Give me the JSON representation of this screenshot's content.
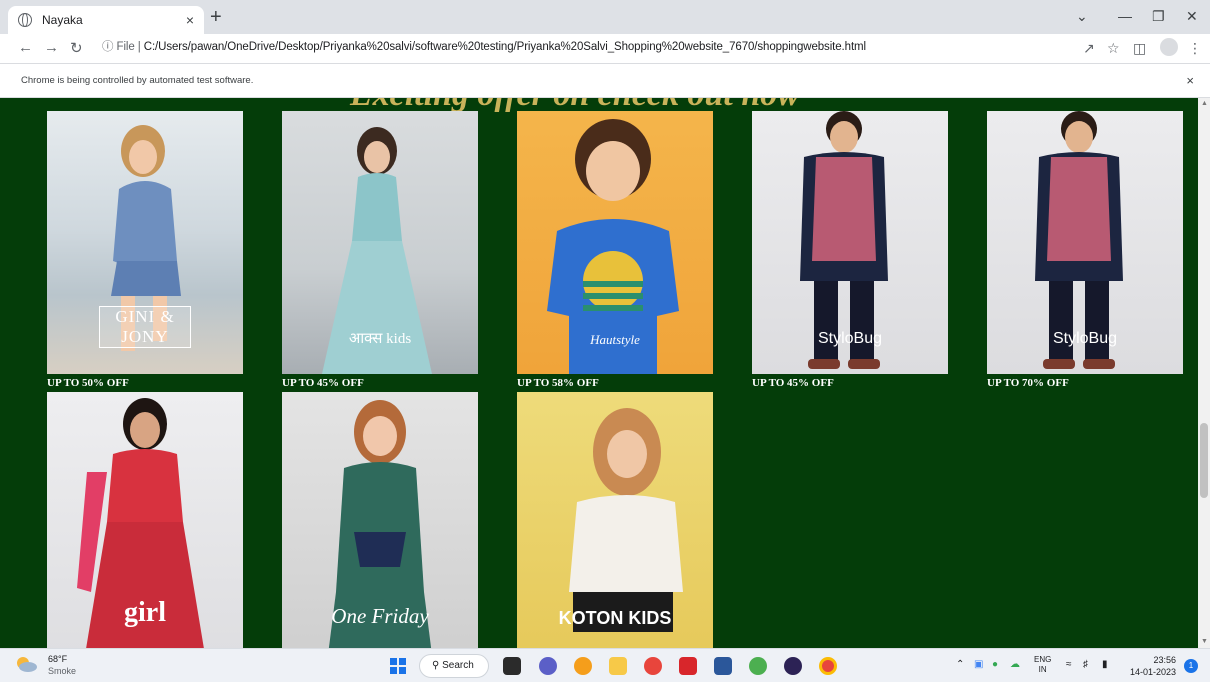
{
  "browser": {
    "tab_title": "Nayaka",
    "tab_close": "×",
    "new_tab": "+",
    "url_prefix": "File",
    "url": "C:/Users/pawan/OneDrive/Desktop/Priyanka%20salvi/software%20testing/Priyanka%20Salvi_Shopping%20website_7670/shoppingwebsite.html",
    "infobar_message": "Chrome is being controlled by automated test software.",
    "infobar_close": "×",
    "icons": [
      "back-arrow-icon",
      "forward-arrow-icon",
      "reload-icon",
      "info-icon",
      "share-icon",
      "star-icon",
      "sidebar-icon",
      "profile-icon",
      "menu-icon"
    ]
  },
  "page": {
    "banner_text": "Exciting offer on check out now",
    "background_color": "#043d09",
    "products": [
      {
        "brand": "GINI & JONY",
        "offer": "UP TO 50% OFF",
        "colors": [
          "#d9dfe3",
          "#7a9bc3"
        ]
      },
      {
        "brand": "आक्स kids",
        "offer": "UP TO 45% OFF",
        "colors": [
          "#cfd3d6",
          "#8cc5c9"
        ]
      },
      {
        "brand": "Hautstyle",
        "offer": "UP TO 58% OFF",
        "colors": [
          "#f2a53a",
          "#2f6fcf"
        ]
      },
      {
        "brand": "StyloBug",
        "offer": "UP TO 45% OFF",
        "colors": [
          "#e3e3e5",
          "#b85a72"
        ]
      },
      {
        "brand": "StyloBug",
        "offer": "UP TO 70% OFF",
        "colors": [
          "#e3e3e5",
          "#b85a72"
        ]
      },
      {
        "brand": "girl",
        "offer": "",
        "colors": [
          "#e9e9eb",
          "#d8323f"
        ]
      },
      {
        "brand": "One Friday",
        "offer": "",
        "colors": [
          "#dcdcdc",
          "#2f6a5c"
        ]
      },
      {
        "brand": "KOTON KIDS",
        "offer": "",
        "colors": [
          "#ecd36a",
          "#f3f0ea"
        ]
      }
    ]
  },
  "taskbar": {
    "weather_temp": "68°F",
    "weather_desc": "Smoke",
    "search_label": "Search",
    "lang_top": "ENG",
    "lang_bottom": "IN",
    "time": "23:56",
    "date": "14-01-2023",
    "notification_count": "1"
  }
}
